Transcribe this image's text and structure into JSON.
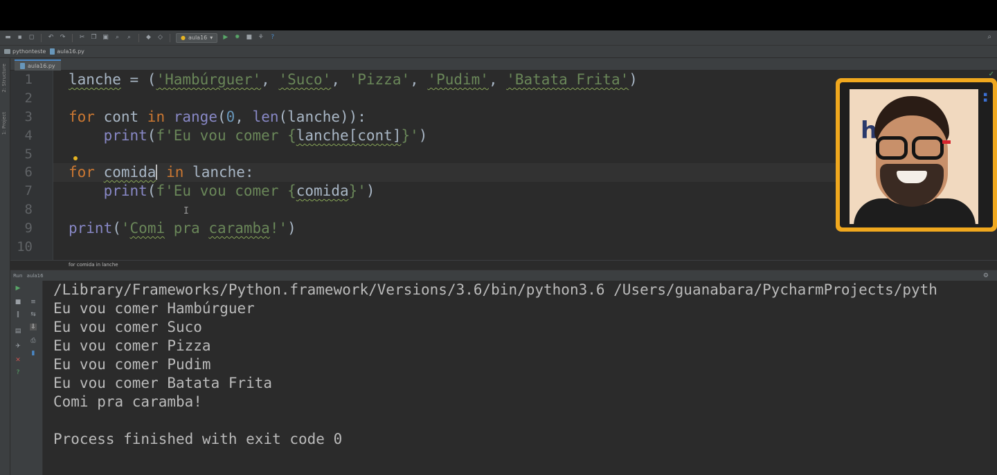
{
  "toolbar": {
    "run_config": "aula16",
    "icons": [
      "open-icon",
      "save-icon",
      "sync-icon",
      "undo-icon",
      "redo-icon",
      "cut-icon",
      "copy-icon",
      "paste-icon",
      "find-icon",
      "replace-icon",
      "back-icon",
      "forward-icon",
      "run-icon",
      "debug-icon",
      "stop-icon",
      "vcs-icon",
      "help-icon",
      "search-icon"
    ]
  },
  "navbar": {
    "project": "pythonteste",
    "file": "aula16.py"
  },
  "tabs": [
    {
      "label": "aula16.py"
    }
  ],
  "side_tabs": [
    "2: Structure",
    "1: Project"
  ],
  "editor": {
    "line_numbers": [
      "1",
      "2",
      "3",
      "4",
      "5",
      "6",
      "7",
      "8",
      "9",
      "10"
    ],
    "lines": {
      "l1": {
        "var": "lanche",
        "eq": " = (",
        "s1": "'Hambúrguer'",
        "c1": ", ",
        "s2": "'Suco'",
        "c2": ", ",
        "s3": "'Pizza'",
        "c3": ", ",
        "s4": "'Pudim'",
        "c4": ", ",
        "s5": "'Batata Frita'",
        "end": ")"
      },
      "l3": {
        "kw_for": "for",
        "var": " cont ",
        "kw_in": "in",
        "sp": " ",
        "fn_range": "range",
        "p1": "(",
        "n0": "0",
        "p2": ", ",
        "fn_len": "len",
        "p3": "(lanche)):"
      },
      "l4": {
        "indent": "    ",
        "fn_print": "print",
        "p1": "(",
        "s1": "f'Eu vou comer {",
        "expr": "lanche[cont]",
        "s2": "}'",
        "end": ")"
      },
      "l6": {
        "kw_for": "for",
        "sp": " ",
        "var": "comida",
        "sp2": " ",
        "kw_in": "in",
        "rest": " lanche:"
      },
      "l7": {
        "indent": "    ",
        "fn_print": "print",
        "p1": "(",
        "s1": "f'Eu vou comer {",
        "expr": "comida",
        "s2": "}'",
        "end": ")"
      },
      "l9": {
        "fn_print": "print",
        "p1": "(",
        "q1": "'",
        "w1": "Comi",
        "mid": " pra ",
        "w2": "caramba",
        "q2": "!'",
        "end": ")"
      }
    },
    "status_breadcrumb": "for comida in lanche"
  },
  "run": {
    "tab_label": "Run",
    "config": "aula16",
    "output": [
      "/Library/Frameworks/Python.framework/Versions/3.6/bin/python3.6 /Users/guanabara/PycharmProjects/pyth",
      "Eu vou comer Hambúrguer",
      "Eu vou comer Suco",
      "Eu vou comer Pizza",
      "Eu vou comer Pudim",
      "Eu vou comer Batata Frita",
      "Comi pra caramba!",
      "",
      "Process finished with exit code 0"
    ]
  },
  "webcam": {
    "logo_text": "h"
  },
  "colors": {
    "keyword": "#cc7832",
    "string": "#6a8759",
    "number": "#6897bb",
    "builtin": "#8888c6",
    "editor_bg": "#2b2b2b",
    "webcam_frame": "#f0a81e"
  }
}
